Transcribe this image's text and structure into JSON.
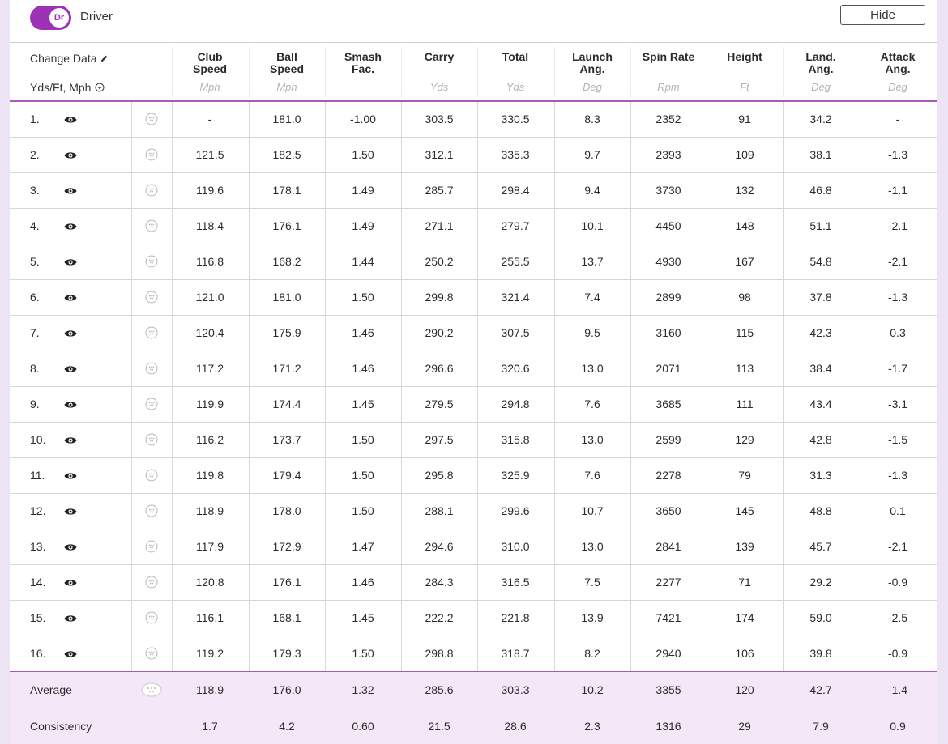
{
  "club": {
    "toggle_code": "Dr",
    "label": "Driver"
  },
  "hide_button": "Hide",
  "header": {
    "change_data": "Change Data",
    "units": "Yds/Ft, Mph",
    "columns": [
      {
        "label": "Club\nSpeed",
        "unit": "Mph"
      },
      {
        "label": "Ball\nSpeed",
        "unit": "Mph"
      },
      {
        "label": "Smash\nFac.",
        "unit": ""
      },
      {
        "label": "Carry",
        "unit": "Yds"
      },
      {
        "label": "Total",
        "unit": "Yds"
      },
      {
        "label": "Launch\nAng.",
        "unit": "Deg"
      },
      {
        "label": "Spin Rate",
        "unit": "Rpm"
      },
      {
        "label": "Height",
        "unit": "Ft"
      },
      {
        "label": "Land.\nAng.",
        "unit": "Deg"
      },
      {
        "label": "Attack\nAng.",
        "unit": "Deg"
      }
    ]
  },
  "shots": [
    {
      "num": "1.",
      "values": [
        "-",
        "181.0",
        "-1.00",
        "303.5",
        "330.5",
        "8.3",
        "2352",
        "91",
        "34.2",
        "-"
      ]
    },
    {
      "num": "2.",
      "values": [
        "121.5",
        "182.5",
        "1.50",
        "312.1",
        "335.3",
        "9.7",
        "2393",
        "109",
        "38.1",
        "-1.3"
      ]
    },
    {
      "num": "3.",
      "values": [
        "119.6",
        "178.1",
        "1.49",
        "285.7",
        "298.4",
        "9.4",
        "3730",
        "132",
        "46.8",
        "-1.1"
      ]
    },
    {
      "num": "4.",
      "values": [
        "118.4",
        "176.1",
        "1.49",
        "271.1",
        "279.7",
        "10.1",
        "4450",
        "148",
        "51.1",
        "-2.1"
      ]
    },
    {
      "num": "5.",
      "values": [
        "116.8",
        "168.2",
        "1.44",
        "250.2",
        "255.5",
        "13.7",
        "4930",
        "167",
        "54.8",
        "-2.1"
      ]
    },
    {
      "num": "6.",
      "values": [
        "121.0",
        "181.0",
        "1.50",
        "299.8",
        "321.4",
        "7.4",
        "2899",
        "98",
        "37.8",
        "-1.3"
      ]
    },
    {
      "num": "7.",
      "values": [
        "120.4",
        "175.9",
        "1.46",
        "290.2",
        "307.5",
        "9.5",
        "3160",
        "115",
        "42.3",
        "0.3"
      ]
    },
    {
      "num": "8.",
      "values": [
        "117.2",
        "171.2",
        "1.46",
        "296.6",
        "320.6",
        "13.0",
        "2071",
        "113",
        "38.4",
        "-1.7"
      ]
    },
    {
      "num": "9.",
      "values": [
        "119.9",
        "174.4",
        "1.45",
        "279.5",
        "294.8",
        "7.6",
        "3685",
        "111",
        "43.4",
        "-3.1"
      ]
    },
    {
      "num": "10.",
      "values": [
        "116.2",
        "173.7",
        "1.50",
        "297.5",
        "315.8",
        "13.0",
        "2599",
        "129",
        "42.8",
        "-1.5"
      ]
    },
    {
      "num": "11.",
      "values": [
        "119.8",
        "179.4",
        "1.50",
        "295.8",
        "325.9",
        "7.6",
        "2278",
        "79",
        "31.3",
        "-1.3"
      ]
    },
    {
      "num": "12.",
      "values": [
        "118.9",
        "178.0",
        "1.50",
        "288.1",
        "299.6",
        "10.7",
        "3650",
        "145",
        "48.8",
        "0.1"
      ]
    },
    {
      "num": "13.",
      "values": [
        "117.9",
        "172.9",
        "1.47",
        "294.6",
        "310.0",
        "13.0",
        "2841",
        "139",
        "45.7",
        "-2.1"
      ]
    },
    {
      "num": "14.",
      "values": [
        "120.8",
        "176.1",
        "1.46",
        "284.3",
        "316.5",
        "7.5",
        "2277",
        "71",
        "29.2",
        "-0.9"
      ]
    },
    {
      "num": "15.",
      "values": [
        "116.1",
        "168.1",
        "1.45",
        "222.2",
        "221.8",
        "13.9",
        "7421",
        "174",
        "59.0",
        "-2.5"
      ]
    },
    {
      "num": "16.",
      "values": [
        "119.2",
        "179.3",
        "1.50",
        "298.8",
        "318.7",
        "8.2",
        "2940",
        "106",
        "39.8",
        "-0.9"
      ]
    }
  ],
  "average": {
    "label": "Average",
    "values": [
      "118.9",
      "176.0",
      "1.32",
      "285.6",
      "303.3",
      "10.2",
      "3355",
      "120",
      "42.7",
      "-1.4"
    ]
  },
  "consistency": {
    "label": "Consistency",
    "values": [
      "1.7",
      "4.2",
      "0.60",
      "21.5",
      "28.6",
      "2.3",
      "1316",
      "29",
      "7.9",
      "0.9"
    ]
  },
  "colors": {
    "accent": "#9c32b5",
    "rule": "#a75ab9",
    "summary_bg": "#f4e7f8"
  },
  "icons": {
    "row_visibility": "eye-icon",
    "row_ball": "golf-ball-icon",
    "edit": "pencil-icon",
    "units_menu": "chevron-down-circle-icon"
  }
}
